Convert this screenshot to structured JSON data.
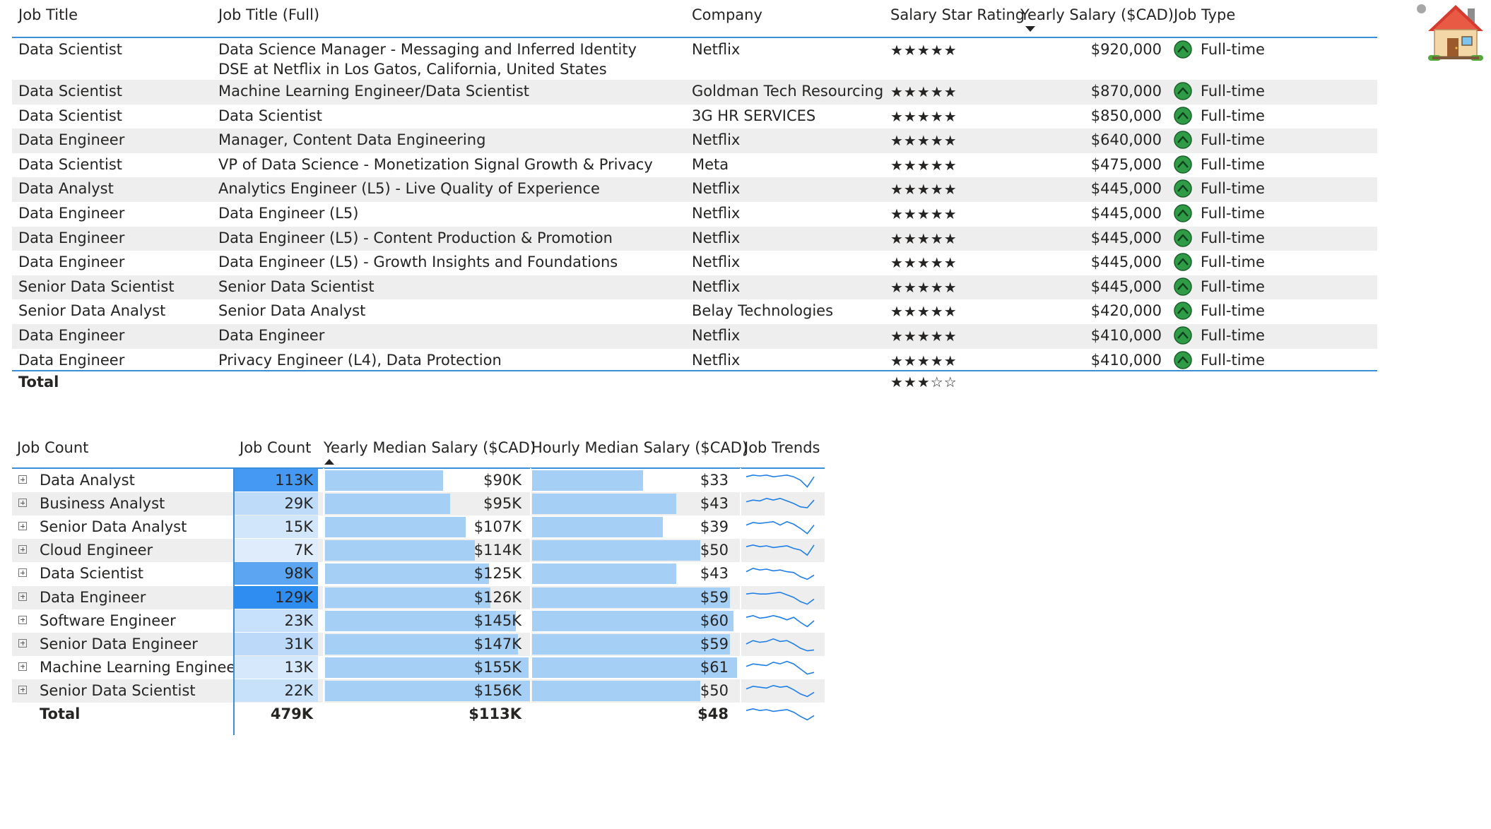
{
  "jobs_table": {
    "columns": [
      "Job Title",
      "Job Title (Full)",
      "Company",
      "Salary Star Rating",
      "Yearly Salary ($CAD)",
      "Job Type"
    ],
    "rows": [
      {
        "title": "Data Scientist",
        "full": "Data Science Manager - Messaging and Inferred Identity DSE at Netflix in Los Gatos, California, United States",
        "company": "Netflix",
        "stars": "★★★★★",
        "salary": "$920,000",
        "type": "Full-time"
      },
      {
        "title": "Data Scientist",
        "full": "Machine Learning Engineer/Data Scientist",
        "company": "Goldman Tech Resourcing",
        "stars": "★★★★★",
        "salary": "$870,000",
        "type": "Full-time"
      },
      {
        "title": "Data Scientist",
        "full": "Data Scientist",
        "company": "3G HR SERVICES",
        "stars": "★★★★★",
        "salary": "$850,000",
        "type": "Full-time"
      },
      {
        "title": "Data Engineer",
        "full": "Manager, Content Data Engineering",
        "company": "Netflix",
        "stars": "★★★★★",
        "salary": "$640,000",
        "type": "Full-time"
      },
      {
        "title": "Data Scientist",
        "full": "VP of Data Science - Monetization Signal Growth & Privacy",
        "company": "Meta",
        "stars": "★★★★★",
        "salary": "$475,000",
        "type": "Full-time"
      },
      {
        "title": "Data Analyst",
        "full": "Analytics Engineer (L5) - Live Quality of Experience",
        "company": "Netflix",
        "stars": "★★★★★",
        "salary": "$445,000",
        "type": "Full-time"
      },
      {
        "title": "Data Engineer",
        "full": "Data Engineer (L5)",
        "company": "Netflix",
        "stars": "★★★★★",
        "salary": "$445,000",
        "type": "Full-time"
      },
      {
        "title": "Data Engineer",
        "full": "Data Engineer (L5) - Content Production & Promotion",
        "company": "Netflix",
        "stars": "★★★★★",
        "salary": "$445,000",
        "type": "Full-time"
      },
      {
        "title": "Data Engineer",
        "full": "Data Engineer (L5) - Growth Insights and Foundations",
        "company": "Netflix",
        "stars": "★★★★★",
        "salary": "$445,000",
        "type": "Full-time"
      },
      {
        "title": "Senior Data Scientist",
        "full": "Senior Data Scientist",
        "company": "Netflix",
        "stars": "★★★★★",
        "salary": "$445,000",
        "type": "Full-time"
      },
      {
        "title": "Senior Data Analyst",
        "full": "Senior Data Analyst",
        "company": "Belay Technologies",
        "stars": "★★★★★",
        "salary": "$420,000",
        "type": "Full-time"
      },
      {
        "title": "Data Engineer",
        "full": "Data Engineer",
        "company": "Netflix",
        "stars": "★★★★★",
        "salary": "$410,000",
        "type": "Full-time"
      },
      {
        "title": "Data Engineer",
        "full": "Privacy Engineer (L4), Data Protection",
        "company": "Netflix",
        "stars": "★★★★★",
        "salary": "$410,000",
        "type": "Full-time"
      }
    ],
    "total_label": "Total",
    "total_stars": "★★★☆☆",
    "sort_column": "Yearly Salary ($CAD)",
    "sort_direction": "descending"
  },
  "matrix": {
    "columns": [
      "Job Count",
      "Job Count",
      "Yearly Median Salary ($CAD)",
      "Hourly Median Salary ($CAD)",
      "Job Trends"
    ],
    "sort_column": "Yearly Median Salary ($CAD)",
    "sort_direction": "ascending",
    "rows": [
      {
        "label": "Data Analyst",
        "count": "113K",
        "count_num": 113,
        "yearly": "$90K",
        "yearly_num": 90,
        "hourly": "$33",
        "hourly_num": 33,
        "trend": [
          0.3,
          0.2,
          0.25,
          0.2,
          0.3,
          0.25,
          0.2,
          0.3,
          0.5,
          0.9,
          0.3
        ]
      },
      {
        "label": "Business Analyst",
        "count": "29K",
        "count_num": 29,
        "yearly": "$95K",
        "yearly_num": 95,
        "hourly": "$43",
        "hourly_num": 43,
        "trend": [
          0.4,
          0.3,
          0.35,
          0.2,
          0.3,
          0.2,
          0.35,
          0.5,
          0.7,
          0.75,
          0.3
        ]
      },
      {
        "label": "Senior Data Analyst",
        "count": "15K",
        "count_num": 15,
        "yearly": "$107K",
        "yearly_num": 107,
        "hourly": "$39",
        "hourly_num": 39,
        "trend": [
          0.4,
          0.25,
          0.3,
          0.25,
          0.2,
          0.4,
          0.2,
          0.35,
          0.6,
          0.9,
          0.4
        ]
      },
      {
        "label": "Cloud Engineer",
        "count": "7K",
        "count_num": 7,
        "yearly": "$114K",
        "yearly_num": 114,
        "hourly": "$50",
        "hourly_num": 50,
        "trend": [
          0.3,
          0.2,
          0.3,
          0.25,
          0.35,
          0.3,
          0.25,
          0.4,
          0.5,
          0.8,
          0.2
        ]
      },
      {
        "label": "Data Scientist",
        "count": "98K",
        "count_num": 98,
        "yearly": "$125K",
        "yearly_num": 125,
        "hourly": "$43",
        "hourly_num": 43,
        "trend": [
          0.4,
          0.2,
          0.3,
          0.25,
          0.35,
          0.3,
          0.4,
          0.45,
          0.7,
          0.85,
          0.6
        ]
      },
      {
        "label": "Data Engineer",
        "count": "129K",
        "count_num": 129,
        "yearly": "$126K",
        "yearly_num": 126,
        "hourly": "$59",
        "hourly_num": 59,
        "trend": [
          0.3,
          0.25,
          0.3,
          0.3,
          0.25,
          0.2,
          0.35,
          0.5,
          0.75,
          0.9,
          0.6
        ]
      },
      {
        "label": "Software Engineer",
        "count": "23K",
        "count_num": 23,
        "yearly": "$145K",
        "yearly_num": 145,
        "hourly": "$60",
        "hourly_num": 60,
        "trend": [
          0.3,
          0.2,
          0.35,
          0.3,
          0.2,
          0.3,
          0.45,
          0.3,
          0.6,
          0.85,
          0.5
        ]
      },
      {
        "label": "Senior Data Engineer",
        "count": "31K",
        "count_num": 31,
        "yearly": "$147K",
        "yearly_num": 147,
        "hourly": "$59",
        "hourly_num": 59,
        "trend": [
          0.5,
          0.3,
          0.4,
          0.35,
          0.2,
          0.35,
          0.3,
          0.5,
          0.75,
          0.9,
          0.85
        ]
      },
      {
        "label": "Machine Learning Engineer",
        "count": "13K",
        "count_num": 13,
        "yearly": "$155K",
        "yearly_num": 155,
        "hourly": "$61",
        "hourly_num": 61,
        "trend": [
          0.45,
          0.3,
          0.35,
          0.4,
          0.2,
          0.3,
          0.15,
          0.3,
          0.6,
          0.9,
          0.8
        ]
      },
      {
        "label": "Senior Data Scientist",
        "count": "22K",
        "count_num": 22,
        "yearly": "$156K",
        "yearly_num": 156,
        "hourly": "$50",
        "hourly_num": 50,
        "trend": [
          0.4,
          0.25,
          0.3,
          0.35,
          0.2,
          0.3,
          0.25,
          0.45,
          0.7,
          0.85,
          0.6
        ]
      }
    ],
    "total": {
      "label": "Total",
      "count": "479K",
      "yearly": "$113K",
      "hourly": "$48",
      "trend": [
        0.3,
        0.2,
        0.3,
        0.25,
        0.35,
        0.3,
        0.25,
        0.4,
        0.65,
        0.85,
        0.6
      ]
    },
    "count_max": 129,
    "yearly_max": 156,
    "hourly_max": 61
  },
  "colors": {
    "header_rule": "#3a8fd8",
    "row_alt": "#eeeeee",
    "bar": "#a6cff6",
    "count_heat": "#2f8cf0",
    "sparkline": "#1f7fe6",
    "job_type_icon": "#2e9b47"
  },
  "icons": {
    "home": "house-icon",
    "job_type": "chevron-up-circle-icon"
  }
}
